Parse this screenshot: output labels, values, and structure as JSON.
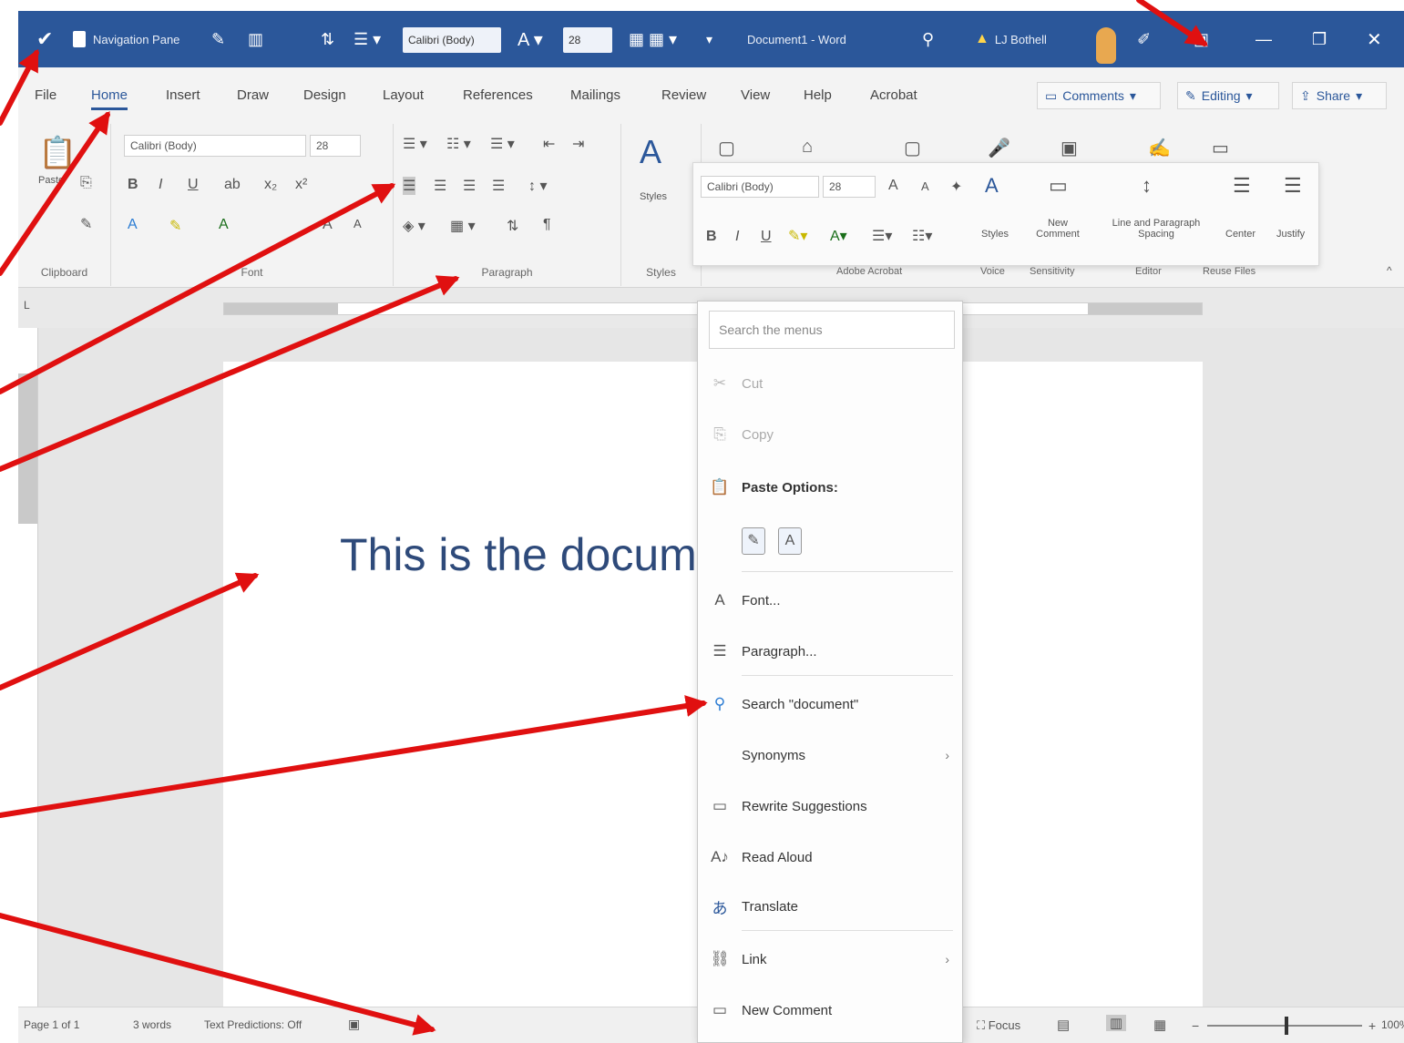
{
  "titlebar": {
    "nav_pane_label": "Navigation Pane",
    "font_name": "Calibri (Body)",
    "font_size": "28",
    "doc_title": "Document1 - Word",
    "user_name": "LJ Bothell"
  },
  "menu_tabs": [
    "File",
    "Home",
    "Insert",
    "Draw",
    "Design",
    "Layout",
    "References",
    "Mailings",
    "Review",
    "View",
    "Help",
    "Acrobat"
  ],
  "active_tab": "Home",
  "ribbon_buttons": {
    "comments": "Comments",
    "editing": "Editing",
    "share": "Share"
  },
  "ribbon": {
    "clipboard_label": "Clipboard",
    "paste_label": "Paste",
    "font_label": "Font",
    "font_name": "Calibri (Body)",
    "font_size": "28",
    "paragraph_label": "Paragraph",
    "styles_label": "Styles",
    "styles_button": "Styles",
    "adobe_label": "Adobe Acrobat",
    "voice_label": "Voice",
    "sensitivity_label": "Sensitivity",
    "editor_label": "Editor",
    "reuse_label": "Reuse Files"
  },
  "mini_toolbar": {
    "font_name": "Calibri (Body)",
    "font_size": "28",
    "styles_label": "Styles",
    "new_comment_label": "New Comment",
    "line_spacing_label": "Line and Paragraph Spacing",
    "center_label": "Center",
    "justify_label": "Justify"
  },
  "document": {
    "body_text": "This is the documer"
  },
  "context_menu": {
    "search_placeholder": "Search the menus",
    "items": [
      {
        "label": "Cut",
        "icon": "scissors-icon",
        "disabled": true
      },
      {
        "label": "Copy",
        "icon": "copy-icon",
        "disabled": true
      },
      {
        "label": "Paste Options:",
        "icon": "paste-icon",
        "header": true
      },
      {
        "label": "Font...",
        "icon": "font-icon"
      },
      {
        "label": "Paragraph...",
        "icon": "paragraph-icon"
      },
      {
        "label": "Search \"document\"",
        "icon": "search-icon"
      },
      {
        "label": "Synonyms",
        "icon": "",
        "submenu": true
      },
      {
        "label": "Rewrite Suggestions",
        "icon": "rewrite-icon"
      },
      {
        "label": "Read Aloud",
        "icon": "read-aloud-icon"
      },
      {
        "label": "Translate",
        "icon": "translate-icon"
      },
      {
        "label": "Link",
        "icon": "link-icon",
        "submenu": true
      },
      {
        "label": "New Comment",
        "icon": "comment-icon"
      }
    ]
  },
  "statusbar": {
    "page": "Page 1 of 1",
    "words": "3 words",
    "text_predictions": "Text Predictions: Off",
    "focus": "Focus",
    "zoom": "100%"
  },
  "colors": {
    "title_blue": "#2b579a",
    "annotation_red": "#e01010",
    "doc_text": "#2e4a7a"
  }
}
